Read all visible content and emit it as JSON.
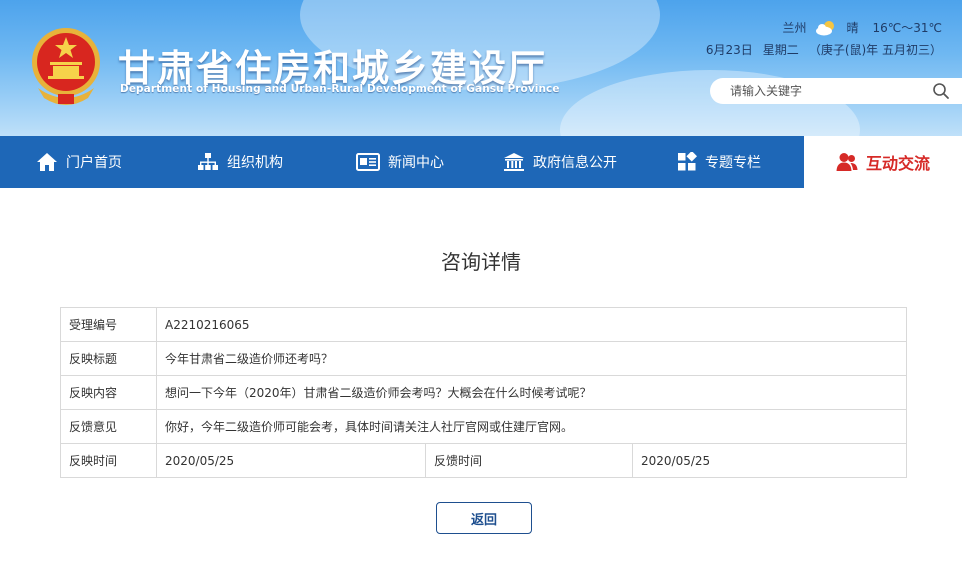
{
  "header": {
    "title": "甘肃省住房和城乡建设厅",
    "subtitle": "Department of Housing and Urban-Rural Development of Gansu Province",
    "weather": {
      "city": "兰州",
      "condition": "晴",
      "temperature": "16℃～31℃",
      "date": "6月23日",
      "weekday": "星期二",
      "lunar": "（庚子(鼠)年 五月初三）"
    },
    "search": {
      "placeholder": "请输入关键字"
    }
  },
  "nav": {
    "items": [
      {
        "label": "门户首页",
        "icon": "home-icon"
      },
      {
        "label": "组织机构",
        "icon": "org-chart-icon"
      },
      {
        "label": "新闻中心",
        "icon": "newspaper-icon"
      },
      {
        "label": "政府信息公开",
        "icon": "government-building-icon"
      },
      {
        "label": "专题专栏",
        "icon": "grid-icon"
      },
      {
        "label": "互动交流",
        "icon": "users-icon",
        "active": true
      }
    ]
  },
  "detail": {
    "heading": "咨询详情",
    "rows": [
      {
        "label": "受理编号",
        "value": "A2210216065"
      },
      {
        "label": "反映标题",
        "value": "今年甘肃省二级造价师还考吗？"
      },
      {
        "label": "反映内容",
        "value": "想问一下今年（2020年）甘肃省二级造价师会考吗？大概会在什么时候考试呢？"
      },
      {
        "label": "反馈意见",
        "value": "你好，今年二级造价师可能会考，具体时间请关注人社厅官网或住建厅官网。"
      }
    ],
    "time_row": {
      "submit_label": "反映时间",
      "submit_value": "2020/05/25",
      "reply_label": "反馈时间",
      "reply_value": "2020/05/25"
    },
    "back_label": "返回"
  },
  "colors": {
    "nav_bg": "#1e67b7",
    "active_text": "#d62a27",
    "button_border": "#1e4f8f"
  }
}
